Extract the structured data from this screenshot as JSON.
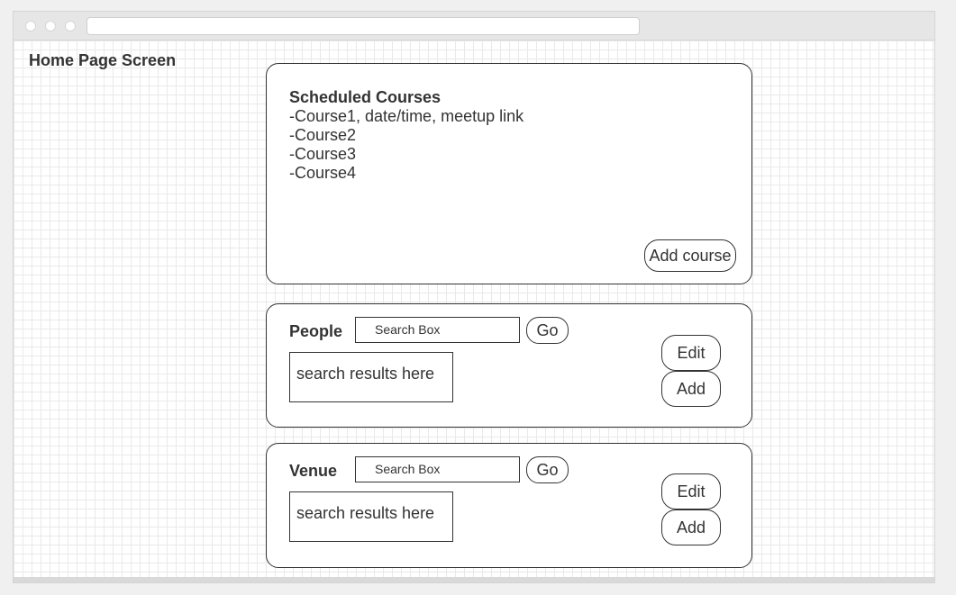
{
  "page": {
    "title": "Home Page Screen"
  },
  "courses": {
    "heading": "Scheduled Courses",
    "items": [
      "-Course1, date/time, meetup link",
      "-Course2",
      "-Course3",
      "-Course4"
    ],
    "add_label": "Add course"
  },
  "people": {
    "label": "People",
    "search_text": "Search Box",
    "go_label": "Go",
    "results_text": "search results here",
    "edit_label": "Edit",
    "add_label": "Add"
  },
  "venue": {
    "label": "Venue",
    "search_text": "Search Box",
    "go_label": "Go",
    "results_text": "search results here",
    "edit_label": "Edit",
    "add_label": "Add"
  }
}
